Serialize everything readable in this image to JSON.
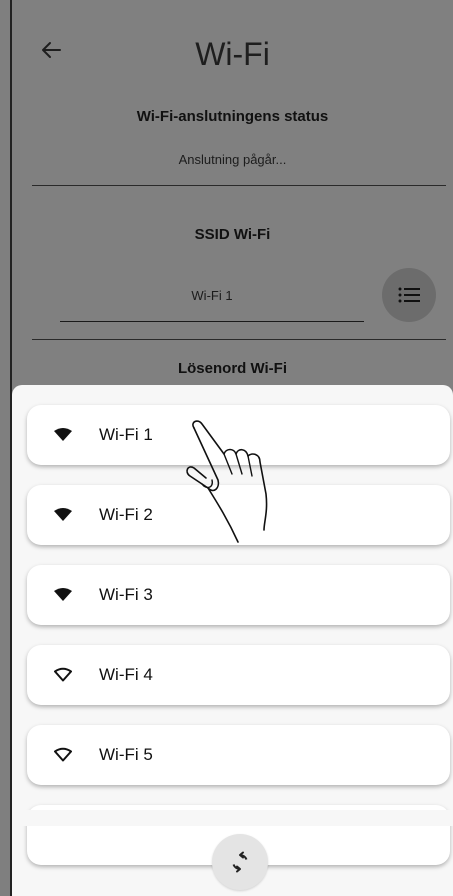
{
  "header": {
    "title": "Wi-Fi",
    "back_icon": "arrow-left-icon"
  },
  "status": {
    "label": "Wi-Fi-anslutningens status",
    "value": "Anslutning pågår..."
  },
  "ssid": {
    "label": "SSID Wi-Fi",
    "value": "Wi-Fi 1",
    "list_button_icon": "list-icon"
  },
  "password": {
    "label": "Lösenord Wi-Fi"
  },
  "networks": [
    {
      "name": "Wi-Fi 1",
      "icon": "wifi-filled-icon"
    },
    {
      "name": "Wi-Fi 2",
      "icon": "wifi-filled-icon"
    },
    {
      "name": "Wi-Fi 3",
      "icon": "wifi-filled-icon"
    },
    {
      "name": "Wi-Fi 4",
      "icon": "wifi-outline-icon"
    },
    {
      "name": "Wi-Fi 5",
      "icon": "wifi-outline-icon"
    }
  ],
  "refresh_button_icon": "refresh-icon",
  "gesture_icon": "tap-hand-icon",
  "colors": {
    "overlay": "#808080",
    "sheet": "#f7f7f7",
    "card": "#ffffff",
    "text": "#111111"
  }
}
